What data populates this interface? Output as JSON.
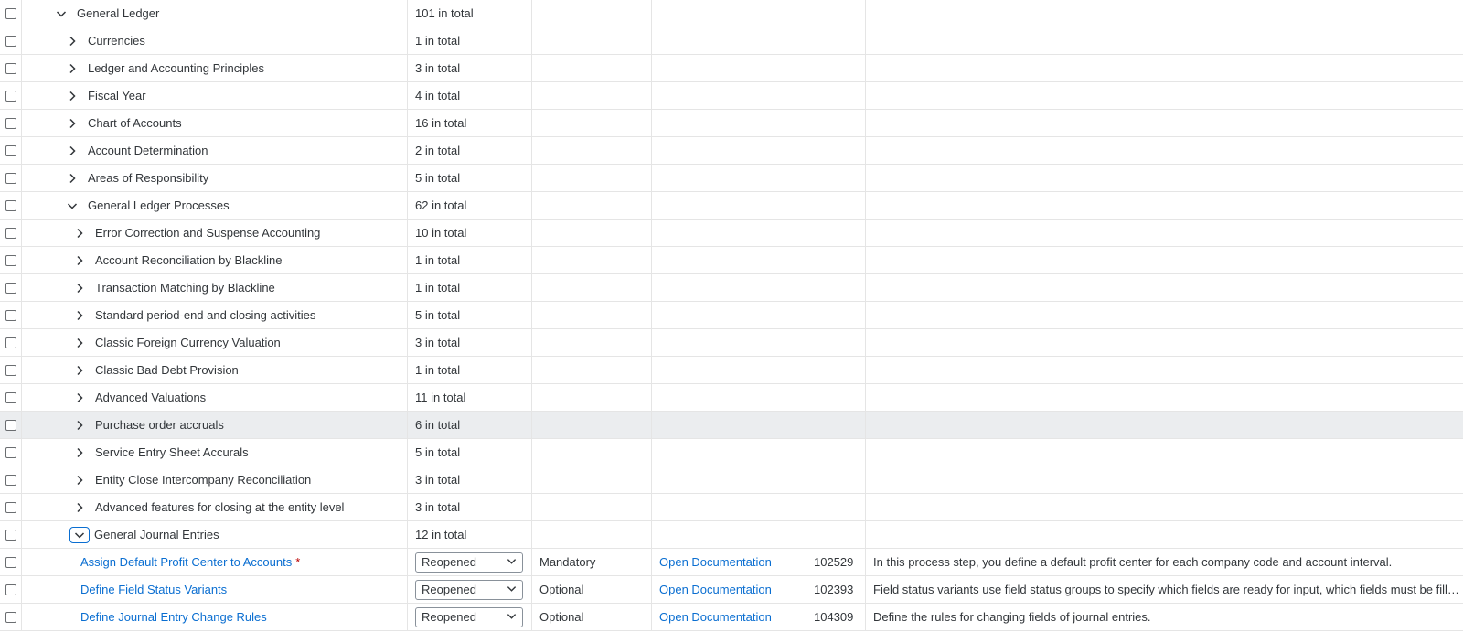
{
  "rows": [
    {
      "kind": "group",
      "level": 0,
      "expanded": true,
      "label": "General Ledger",
      "count": "101 in total"
    },
    {
      "kind": "group",
      "level": 1,
      "expanded": false,
      "label": "Currencies",
      "count": "1 in total"
    },
    {
      "kind": "group",
      "level": 1,
      "expanded": false,
      "label": "Ledger and Accounting Principles",
      "count": "3 in total"
    },
    {
      "kind": "group",
      "level": 1,
      "expanded": false,
      "label": "Fiscal Year",
      "count": "4 in total"
    },
    {
      "kind": "group",
      "level": 1,
      "expanded": false,
      "label": "Chart of Accounts",
      "count": "16 in total"
    },
    {
      "kind": "group",
      "level": 1,
      "expanded": false,
      "label": "Account Determination",
      "count": "2 in total"
    },
    {
      "kind": "group",
      "level": 1,
      "expanded": false,
      "label": "Areas of Responsibility",
      "count": "5 in total"
    },
    {
      "kind": "group",
      "level": 1,
      "expanded": true,
      "label": "General Ledger Processes",
      "count": "62 in total"
    },
    {
      "kind": "group",
      "level": 2,
      "expanded": false,
      "label": "Error Correction and Suspense Accounting",
      "count": "10 in total"
    },
    {
      "kind": "group",
      "level": 2,
      "expanded": false,
      "label": "Account Reconciliation by Blackline",
      "count": "1 in total"
    },
    {
      "kind": "group",
      "level": 2,
      "expanded": false,
      "label": "Transaction Matching by Blackline",
      "count": "1 in total"
    },
    {
      "kind": "group",
      "level": 2,
      "expanded": false,
      "label": "Standard period-end and closing activities",
      "count": "5 in total"
    },
    {
      "kind": "group",
      "level": 2,
      "expanded": false,
      "label": "Classic Foreign Currency Valuation",
      "count": "3 in total"
    },
    {
      "kind": "group",
      "level": 2,
      "expanded": false,
      "label": "Classic Bad Debt Provision",
      "count": "1 in total"
    },
    {
      "kind": "group",
      "level": 2,
      "expanded": false,
      "label": "Advanced Valuations",
      "count": "11 in total"
    },
    {
      "kind": "group",
      "level": 2,
      "expanded": false,
      "label": "Purchase order accruals",
      "count": "6 in total",
      "hover": true
    },
    {
      "kind": "group",
      "level": 2,
      "expanded": false,
      "label": "Service Entry Sheet Accurals",
      "count": "5 in total"
    },
    {
      "kind": "group",
      "level": 2,
      "expanded": false,
      "label": "Entity Close Intercompany Reconciliation",
      "count": "3 in total"
    },
    {
      "kind": "group",
      "level": 2,
      "expanded": false,
      "label": "Advanced features for closing at the entity level",
      "count": "3 in total"
    },
    {
      "kind": "group",
      "level": 2,
      "expanded": true,
      "focused": true,
      "label": "General Journal Entries",
      "count": "12 in total"
    },
    {
      "kind": "leaf",
      "label": "Assign Default Profit Center to Accounts",
      "required": "*",
      "status": "Reopened",
      "req_type": "Mandatory",
      "doc": "Open Documentation",
      "id": "102529",
      "desc": "In this process step, you define a default profit center for each company code and account interval."
    },
    {
      "kind": "leaf",
      "label": "Define Field Status Variants",
      "required": "",
      "status": "Reopened",
      "req_type": "Optional",
      "doc": "Open Documentation",
      "id": "102393",
      "desc": "Field status variants use field status groups to specify which fields are ready for input, which fields must be fille..."
    },
    {
      "kind": "leaf",
      "label": "Define Journal Entry Change Rules",
      "required": "",
      "status": "Reopened",
      "req_type": "Optional",
      "doc": "Open Documentation",
      "id": "104309",
      "desc": "Define the rules for changing fields of journal entries."
    }
  ],
  "icons": {
    "expand": "chevron-right-icon",
    "collapse": "chevron-down-icon",
    "dropdown": "chevron-down-icon"
  },
  "colors": {
    "link": "#0a6ed1",
    "required": "#bb0000",
    "hover_row": "#ebedef",
    "focus": "#0a6ed1"
  }
}
